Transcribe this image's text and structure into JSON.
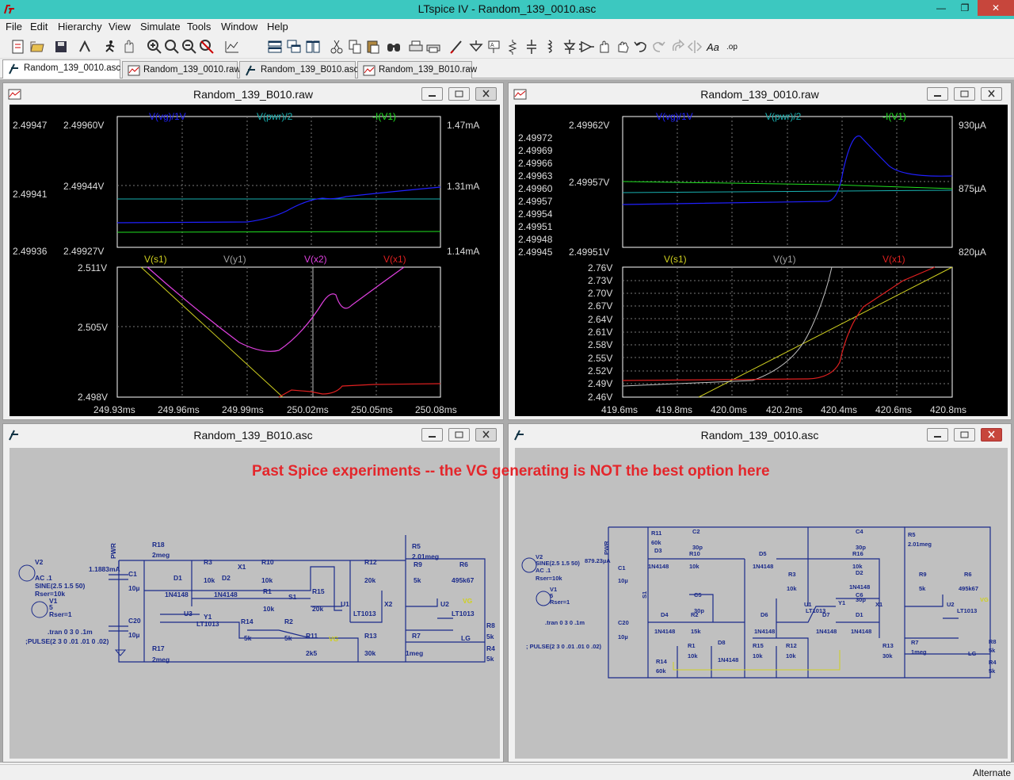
{
  "app": {
    "title": "LTspice IV - Random_139_0010.asc",
    "window_buttons": {
      "minimize": "—",
      "restore": "❐",
      "close": "✕"
    }
  },
  "menu": [
    "File",
    "Edit",
    "Hierarchy",
    "View",
    "Simulate",
    "Tools",
    "Window",
    "Help"
  ],
  "toolbar_icons": [
    "new-schematic-icon",
    "open-icon",
    "save-icon",
    "control-panel-icon",
    "run-icon",
    "halt-icon",
    "zoom-in-icon",
    "pan-icon",
    "zoom-out-icon",
    "zoom-fit-icon",
    "autorange-icon",
    "tile-horizontal-icon",
    "cascade-icon",
    "tile-vertical-icon",
    "cut-icon",
    "copy-icon",
    "paste-icon",
    "find-icon",
    "print-icon",
    "print-setup-icon",
    "draw-wire-icon",
    "ground-icon",
    "label-net-icon",
    "resistor-icon",
    "capacitor-icon",
    "inductor-icon",
    "diode-icon",
    "component-icon",
    "move-icon",
    "drag-icon",
    "undo-icon",
    "redo-icon",
    "rotate-icon",
    "mirror-icon",
    "text-icon",
    "spice-directive-icon"
  ],
  "tabs": [
    {
      "label": "Random_139_0010.asc",
      "kind": "schematic",
      "active": true
    },
    {
      "label": "Random_139_0010.raw",
      "kind": "waveform",
      "active": false
    },
    {
      "label": "Random_139_B010.asc",
      "kind": "schematic",
      "active": false
    },
    {
      "label": "Random_139_B010.raw",
      "kind": "waveform",
      "active": false
    }
  ],
  "windows": {
    "plot_left_title": "Random_139_B010.raw",
    "plot_right_title": "Random_139_0010.raw",
    "sch_left_title": "Random_139_B010.asc",
    "sch_right_title": "Random_139_0010.asc"
  },
  "plot_left": {
    "top_traces": [
      {
        "name": "V(vg)/1V",
        "color": "#2020ff"
      },
      {
        "name": "V(pwr)/2",
        "color": "#18b0b0"
      },
      {
        "name": "-I(V1)",
        "color": "#20e020"
      }
    ],
    "top_left_axis": [
      "2.49947",
      "2.49941",
      "2.49936"
    ],
    "top_mid_axis": [
      "2.49960V",
      "2.49944V",
      "2.49927V"
    ],
    "top_right_axis": [
      "1.47mA",
      "1.31mA",
      "1.14mA"
    ],
    "bottom_traces": [
      {
        "name": "V(s1)",
        "color": "#d0d020"
      },
      {
        "name": "V(y1)",
        "color": "#a0a0a0"
      },
      {
        "name": "V(x2)",
        "color": "#e040e0"
      },
      {
        "name": "V(x1)",
        "color": "#e02020"
      }
    ],
    "bottom_axis": [
      "2.511V",
      "2.505V",
      "2.498V"
    ],
    "x_axis": [
      "249.93ms",
      "249.96ms",
      "249.99ms",
      "250.02ms",
      "250.05ms",
      "250.08ms"
    ]
  },
  "plot_right": {
    "top_traces": [
      {
        "name": "V(vg)/1V",
        "color": "#2020ff"
      },
      {
        "name": "V(pwr)/2",
        "color": "#18b0b0"
      },
      {
        "name": "-I(V1)",
        "color": "#20e020"
      }
    ],
    "top_left_axis": [
      "2.49972",
      "2.49969",
      "2.49966",
      "2.49963",
      "2.49960",
      "2.49957",
      "2.49954",
      "2.49951",
      "2.49948",
      "2.49945"
    ],
    "top_mid_axis": [
      "2.49962V",
      "2.49957V",
      "2.49951V"
    ],
    "top_right_axis": [
      "930µA",
      "875µA",
      "820µA"
    ],
    "bottom_traces": [
      {
        "name": "V(s1)",
        "color": "#d0d020"
      },
      {
        "name": "V(y1)",
        "color": "#a0a0a0"
      },
      {
        "name": "V(x1)",
        "color": "#e02020"
      }
    ],
    "bottom_axis": [
      "2.76V",
      "2.73V",
      "2.70V",
      "2.67V",
      "2.64V",
      "2.61V",
      "2.58V",
      "2.55V",
      "2.52V",
      "2.49V",
      "2.46V"
    ],
    "x_axis": [
      "419.6ms",
      "419.8ms",
      "420.0ms",
      "420.2ms",
      "420.4ms",
      "420.6ms",
      "420.8ms"
    ]
  },
  "annotation": "Past Spice experiments -- the VG generating is NOT the best option here",
  "sch_left": {
    "labels": [
      "PWR",
      "R18",
      "2meg",
      "R3",
      "10k",
      "X1",
      "R10",
      "10k",
      "R12",
      "20k",
      "R5",
      "2.01meg",
      "R9",
      "5k",
      "R6",
      "495k67",
      "VG",
      "D1",
      "1N4148",
      "D2",
      "1N4148",
      "R1",
      "10k",
      "S1",
      "R15",
      "20k",
      "U1",
      "LT1013",
      "X2",
      "U2",
      "LT1013",
      "C1",
      "10µ",
      "U3",
      "Y1",
      "LT1013",
      "R14",
      "5k",
      "R2",
      "5k",
      "R11",
      "2k5",
      "VG",
      "R13",
      "30k",
      "R7",
      "1meg",
      "LG",
      "R8",
      "5k",
      "R4",
      "5k",
      "C20",
      "10µ",
      "R17",
      "2meg",
      "1.1883mA",
      "V2",
      "AC .1",
      "SINE(2.5 1.5 50)",
      "Rser=10k",
      "V1",
      "5",
      "Rser=1",
      ".tran 0 3 0 .1m",
      ";PULSE(2 3 0 .01 .01 0 .02)"
    ]
  },
  "sch_right": {
    "labels": [
      "PWR",
      "R11",
      "60k",
      "D3",
      "1N4148",
      "C2",
      "30p",
      "R10",
      "10k",
      "D5",
      "1N4148",
      "C4",
      "30p",
      "R16",
      "10k",
      "D2",
      "1N4148",
      "C6",
      "30p",
      "R5",
      "2.01meg",
      "R9",
      "5k",
      "R6",
      "495k67",
      "VG",
      "R3",
      "10k",
      "U1",
      "LT1013",
      "X1",
      "U2",
      "LT1013",
      "C1",
      "10µ",
      "S1",
      "C5",
      "30p",
      "D4",
      "1N4148",
      "R2",
      "15k",
      "D6",
      "1N4148",
      "D7",
      "1N4148",
      "Y1",
      "D1",
      "1N4148",
      "C20",
      "10µ",
      "R1",
      "10k",
      "D8",
      "1N4148",
      "R15",
      "10k",
      "R12",
      "10k",
      "R13",
      "30k",
      "R7",
      "1meg",
      "LG",
      "R8",
      "5k",
      "R4",
      "5k",
      "R14",
      "60k",
      "879.23µA",
      "V2",
      "SINE(2.5 1.5 50)",
      "AC .1",
      "Rser=10k",
      "V1",
      "5",
      "Rser=1",
      ".tran 0 3 0 .1m",
      "; PULSE(2 3 0 .01 .01 0 .02)"
    ]
  },
  "status": "Alternate"
}
